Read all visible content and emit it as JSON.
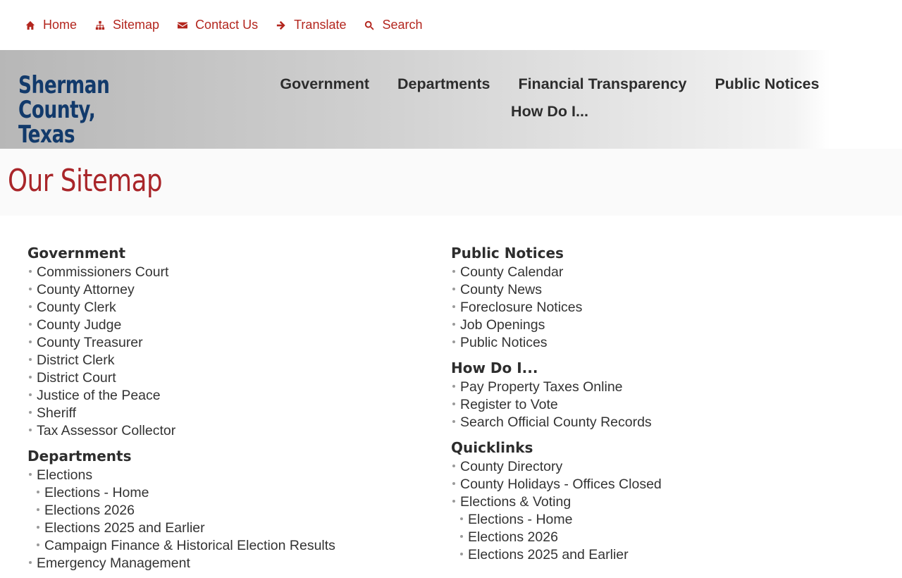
{
  "utility_nav": [
    {
      "icon": "home-icon",
      "label": "Home"
    },
    {
      "icon": "sitemap-icon",
      "label": "Sitemap"
    },
    {
      "icon": "envelope-icon",
      "label": "Contact Us"
    },
    {
      "icon": "arrow-right-icon",
      "label": "Translate"
    },
    {
      "icon": "search-icon",
      "label": "Search"
    }
  ],
  "site": {
    "name_line1": "Sherman County,",
    "name_line2": "Texas"
  },
  "main_nav": [
    "Government",
    "Departments",
    "Financial Transparency",
    "Public Notices",
    "How Do I..."
  ],
  "page": {
    "title": "Our Sitemap"
  },
  "colors": {
    "accent": "#b3261e",
    "brand": "#123a6b",
    "title": "#a9262a"
  },
  "sitemap": {
    "government": {
      "title": "Government",
      "items": [
        "Commissioners Court",
        "County Attorney",
        "County Clerk",
        "County Judge",
        "County Treasurer",
        "District Clerk",
        "District Court",
        "Justice of the Peace",
        "Sheriff",
        "Tax Assessor Collector"
      ]
    },
    "departments": {
      "title": "Departments",
      "items": [
        "Elections"
      ],
      "sub_items": [
        "Elections - Home",
        "Elections 2026",
        "Elections 2025 and Earlier",
        "Campaign Finance & Historical Election Results"
      ],
      "after": [
        "Emergency Management"
      ]
    },
    "public_notices": {
      "title": "Public Notices",
      "items": [
        "County Calendar",
        "County News",
        "Foreclosure Notices",
        "Job Openings",
        "Public Notices"
      ]
    },
    "how_do_i": {
      "title": "How Do I...",
      "items": [
        "Pay Property Taxes Online",
        "Register to Vote",
        "Search Official County Records"
      ]
    },
    "quicklinks": {
      "title": "Quicklinks",
      "items": [
        "County Directory",
        "County Holidays - Offices Closed",
        "Elections & Voting"
      ],
      "sub_items": [
        "Elections - Home",
        "Elections 2026",
        "Elections 2025 and Earlier"
      ]
    }
  }
}
